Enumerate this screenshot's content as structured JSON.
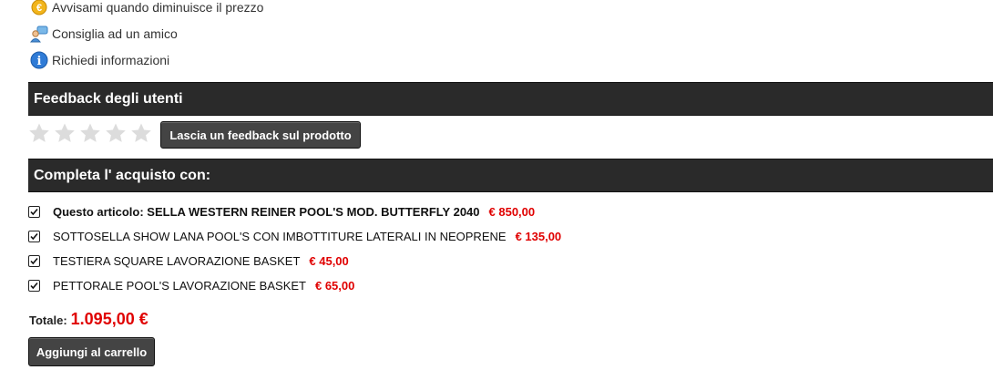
{
  "links": [
    {
      "icon": "euro-coin-icon",
      "label": "Avvisami quando diminuisce il prezzo"
    },
    {
      "icon": "users-chat-icon",
      "label": "Consiglia ad un amico"
    },
    {
      "icon": "info-icon",
      "label": "Richiedi informazioni"
    }
  ],
  "feedback": {
    "title": "Feedback degli utenti",
    "rating": 0,
    "max_rating": 5,
    "button_label": "Lascia un feedback sul prodotto"
  },
  "bundle": {
    "title": "Completa l' acquisto con:",
    "items": [
      {
        "checked": true,
        "label": "Questo articolo: SELLA WESTERN REINER POOL'S MOD. BUTTERFLY 2040",
        "price": "€ 850,00"
      },
      {
        "checked": true,
        "label": "SOTTOSELLA SHOW LANA POOL'S CON IMBOTTITURE LATERALI IN NEOPRENE",
        "price": "€ 135,00"
      },
      {
        "checked": true,
        "label": "TESTIERA SQUARE LAVORAZIONE BASKET",
        "price": "€ 45,00"
      },
      {
        "checked": true,
        "label": "PETTORALE POOL'S LAVORAZIONE BASKET",
        "price": "€ 65,00"
      }
    ],
    "total_label": "Totale:",
    "total_value": "1.095,00 €",
    "add_to_cart_label": "Aggiungi al carrello"
  },
  "colors": {
    "price": "#e00000",
    "bar": "#2a2a2a",
    "button": "#444444"
  }
}
